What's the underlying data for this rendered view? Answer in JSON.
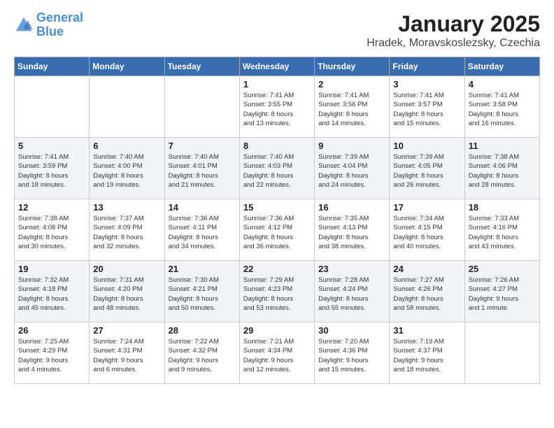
{
  "header": {
    "logo_line1": "General",
    "logo_line2": "Blue",
    "month": "January 2025",
    "location": "Hradek, Moravskoslezsky, Czechia"
  },
  "days_of_week": [
    "Sunday",
    "Monday",
    "Tuesday",
    "Wednesday",
    "Thursday",
    "Friday",
    "Saturday"
  ],
  "weeks": [
    [
      {
        "day": "",
        "info": ""
      },
      {
        "day": "",
        "info": ""
      },
      {
        "day": "",
        "info": ""
      },
      {
        "day": "1",
        "info": "Sunrise: 7:41 AM\nSunset: 3:55 PM\nDaylight: 8 hours\nand 13 minutes."
      },
      {
        "day": "2",
        "info": "Sunrise: 7:41 AM\nSunset: 3:56 PM\nDaylight: 8 hours\nand 14 minutes."
      },
      {
        "day": "3",
        "info": "Sunrise: 7:41 AM\nSunset: 3:57 PM\nDaylight: 8 hours\nand 15 minutes."
      },
      {
        "day": "4",
        "info": "Sunrise: 7:41 AM\nSunset: 3:58 PM\nDaylight: 8 hours\nand 16 minutes."
      }
    ],
    [
      {
        "day": "5",
        "info": "Sunrise: 7:41 AM\nSunset: 3:59 PM\nDaylight: 8 hours\nand 18 minutes."
      },
      {
        "day": "6",
        "info": "Sunrise: 7:40 AM\nSunset: 4:00 PM\nDaylight: 8 hours\nand 19 minutes."
      },
      {
        "day": "7",
        "info": "Sunrise: 7:40 AM\nSunset: 4:01 PM\nDaylight: 8 hours\nand 21 minutes."
      },
      {
        "day": "8",
        "info": "Sunrise: 7:40 AM\nSunset: 4:03 PM\nDaylight: 8 hours\nand 22 minutes."
      },
      {
        "day": "9",
        "info": "Sunrise: 7:39 AM\nSunset: 4:04 PM\nDaylight: 8 hours\nand 24 minutes."
      },
      {
        "day": "10",
        "info": "Sunrise: 7:39 AM\nSunset: 4:05 PM\nDaylight: 8 hours\nand 26 minutes."
      },
      {
        "day": "11",
        "info": "Sunrise: 7:38 AM\nSunset: 4:06 PM\nDaylight: 8 hours\nand 28 minutes."
      }
    ],
    [
      {
        "day": "12",
        "info": "Sunrise: 7:38 AM\nSunset: 4:08 PM\nDaylight: 8 hours\nand 30 minutes."
      },
      {
        "day": "13",
        "info": "Sunrise: 7:37 AM\nSunset: 4:09 PM\nDaylight: 8 hours\nand 32 minutes."
      },
      {
        "day": "14",
        "info": "Sunrise: 7:36 AM\nSunset: 4:11 PM\nDaylight: 8 hours\nand 34 minutes."
      },
      {
        "day": "15",
        "info": "Sunrise: 7:36 AM\nSunset: 4:12 PM\nDaylight: 8 hours\nand 36 minutes."
      },
      {
        "day": "16",
        "info": "Sunrise: 7:35 AM\nSunset: 4:13 PM\nDaylight: 8 hours\nand 38 minutes."
      },
      {
        "day": "17",
        "info": "Sunrise: 7:34 AM\nSunset: 4:15 PM\nDaylight: 8 hours\nand 40 minutes."
      },
      {
        "day": "18",
        "info": "Sunrise: 7:33 AM\nSunset: 4:16 PM\nDaylight: 8 hours\nand 43 minutes."
      }
    ],
    [
      {
        "day": "19",
        "info": "Sunrise: 7:32 AM\nSunset: 4:18 PM\nDaylight: 8 hours\nand 45 minutes."
      },
      {
        "day": "20",
        "info": "Sunrise: 7:31 AM\nSunset: 4:20 PM\nDaylight: 8 hours\nand 48 minutes."
      },
      {
        "day": "21",
        "info": "Sunrise: 7:30 AM\nSunset: 4:21 PM\nDaylight: 8 hours\nand 50 minutes."
      },
      {
        "day": "22",
        "info": "Sunrise: 7:29 AM\nSunset: 4:23 PM\nDaylight: 8 hours\nand 53 minutes."
      },
      {
        "day": "23",
        "info": "Sunrise: 7:28 AM\nSunset: 4:24 PM\nDaylight: 8 hours\nand 55 minutes."
      },
      {
        "day": "24",
        "info": "Sunrise: 7:27 AM\nSunset: 4:26 PM\nDaylight: 8 hours\nand 58 minutes."
      },
      {
        "day": "25",
        "info": "Sunrise: 7:26 AM\nSunset: 4:27 PM\nDaylight: 9 hours\nand 1 minute."
      }
    ],
    [
      {
        "day": "26",
        "info": "Sunrise: 7:25 AM\nSunset: 4:29 PM\nDaylight: 9 hours\nand 4 minutes."
      },
      {
        "day": "27",
        "info": "Sunrise: 7:24 AM\nSunset: 4:31 PM\nDaylight: 9 hours\nand 6 minutes."
      },
      {
        "day": "28",
        "info": "Sunrise: 7:22 AM\nSunset: 4:32 PM\nDaylight: 9 hours\nand 9 minutes."
      },
      {
        "day": "29",
        "info": "Sunrise: 7:21 AM\nSunset: 4:34 PM\nDaylight: 9 hours\nand 12 minutes."
      },
      {
        "day": "30",
        "info": "Sunrise: 7:20 AM\nSunset: 4:36 PM\nDaylight: 9 hours\nand 15 minutes."
      },
      {
        "day": "31",
        "info": "Sunrise: 7:19 AM\nSunset: 4:37 PM\nDaylight: 9 hours\nand 18 minutes."
      },
      {
        "day": "",
        "info": ""
      }
    ]
  ]
}
